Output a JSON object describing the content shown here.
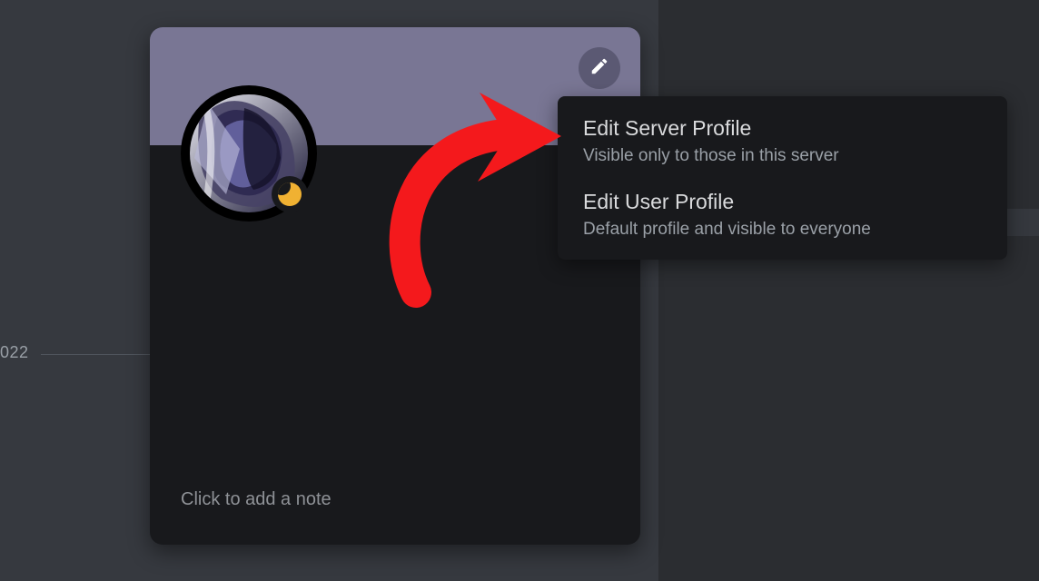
{
  "background": {
    "year_label": "022"
  },
  "profile_popout": {
    "banner_color": "#797694",
    "status": "idle",
    "note_placeholder": "Click to add a note"
  },
  "edit_menu": {
    "items": [
      {
        "title": "Edit Server Profile",
        "subtitle": "Visible only to those in this server"
      },
      {
        "title": "Edit User Profile",
        "subtitle": "Default profile and visible to everyone"
      }
    ]
  }
}
